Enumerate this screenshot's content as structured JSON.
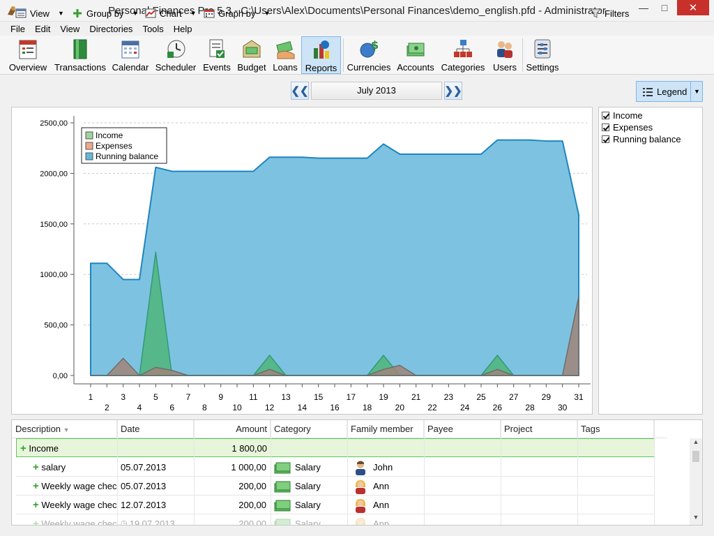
{
  "window": {
    "title": "Personal Finances Pro 5.3 - C:\\Users\\Alex\\Documents\\Personal Finances\\demo_english.pfd - Administrator"
  },
  "menu": [
    "File",
    "Edit",
    "View",
    "Directories",
    "Tools",
    "Help"
  ],
  "toolbar": [
    {
      "label": "Overview",
      "icon": "overview-icon"
    },
    {
      "label": "Transactions",
      "icon": "transactions-icon"
    },
    {
      "label": "Calendar",
      "icon": "calendar-icon"
    },
    {
      "label": "Scheduler",
      "icon": "scheduler-icon"
    },
    {
      "label": "Events",
      "icon": "events-icon"
    },
    {
      "label": "Budget",
      "icon": "budget-icon"
    },
    {
      "label": "Loans",
      "icon": "loans-icon"
    },
    {
      "label": "Reports",
      "icon": "reports-icon",
      "active": true
    },
    {
      "label": "Currencies",
      "icon": "currencies-icon"
    },
    {
      "label": "Accounts",
      "icon": "accounts-icon"
    },
    {
      "label": "Categories",
      "icon": "categories-icon"
    },
    {
      "label": "Users",
      "icon": "users-icon"
    },
    {
      "label": "Settings",
      "icon": "settings-icon"
    }
  ],
  "bar2": {
    "view": "View",
    "group_by": "Group by",
    "chart": "Chart",
    "graph_by": "Graph by",
    "month": "July 2013",
    "filters": "Filters",
    "legend": "Legend"
  },
  "side_legend": [
    "Income",
    "Expenses",
    "Running balance"
  ],
  "chart_data": {
    "type": "area",
    "x": [
      1,
      2,
      3,
      4,
      5,
      6,
      7,
      8,
      9,
      10,
      11,
      12,
      13,
      14,
      15,
      16,
      17,
      18,
      19,
      20,
      21,
      22,
      23,
      24,
      25,
      26,
      27,
      28,
      29,
      30,
      31
    ],
    "ylim": [
      0,
      2500
    ],
    "yticks": [
      "0,00",
      "500,00",
      "1000,00",
      "1500,00",
      "2000,00",
      "2500,00"
    ],
    "grid": true,
    "legend_position": "top-left",
    "series": [
      {
        "name": "Running balance",
        "color": "#7dc3e1",
        "stroke": "#1e84c0",
        "values": [
          1110,
          1110,
          950,
          950,
          2060,
          2020,
          2020,
          2020,
          2020,
          2020,
          2020,
          2160,
          2160,
          2160,
          2150,
          2150,
          2150,
          2150,
          2290,
          2190,
          2190,
          2190,
          2190,
          2190,
          2190,
          2330,
          2330,
          2330,
          2320,
          2320,
          1590
        ]
      },
      {
        "name": "Income",
        "color": "#4fb57a",
        "stroke": "#2f9a7a",
        "values": [
          0,
          0,
          0,
          0,
          1220,
          0,
          0,
          0,
          0,
          0,
          0,
          200,
          0,
          0,
          0,
          0,
          0,
          0,
          200,
          0,
          0,
          0,
          0,
          0,
          0,
          200,
          0,
          0,
          0,
          0,
          0
        ]
      },
      {
        "name": "Expenses",
        "color": "#a08578",
        "stroke": "#6d6d6d",
        "values": [
          0,
          0,
          170,
          0,
          80,
          50,
          0,
          0,
          0,
          0,
          0,
          60,
          0,
          0,
          0,
          0,
          0,
          0,
          60,
          100,
          0,
          0,
          0,
          0,
          0,
          60,
          0,
          0,
          0,
          0,
          780
        ]
      }
    ]
  },
  "table": {
    "columns": [
      "Description",
      "Date",
      "Amount",
      "Category",
      "Family member",
      "Payee",
      "Project",
      "Tags"
    ],
    "group": {
      "label": "Income",
      "amount": "1 800,00"
    },
    "rows": [
      {
        "desc": "salary",
        "date": "05.07.2013",
        "amount": "1 000,00",
        "category": "Salary",
        "member": "John"
      },
      {
        "desc": "Weekly wage chec",
        "date": "05.07.2013",
        "amount": "200,00",
        "category": "Salary",
        "member": "Ann"
      },
      {
        "desc": "Weekly wage chec",
        "date": "12.07.2013",
        "amount": "200,00",
        "category": "Salary",
        "member": "Ann"
      },
      {
        "desc": "Weekly wage chec",
        "date": "19.07.2013",
        "amount": "200,00",
        "category": "Salary",
        "member": "Ann"
      }
    ]
  }
}
